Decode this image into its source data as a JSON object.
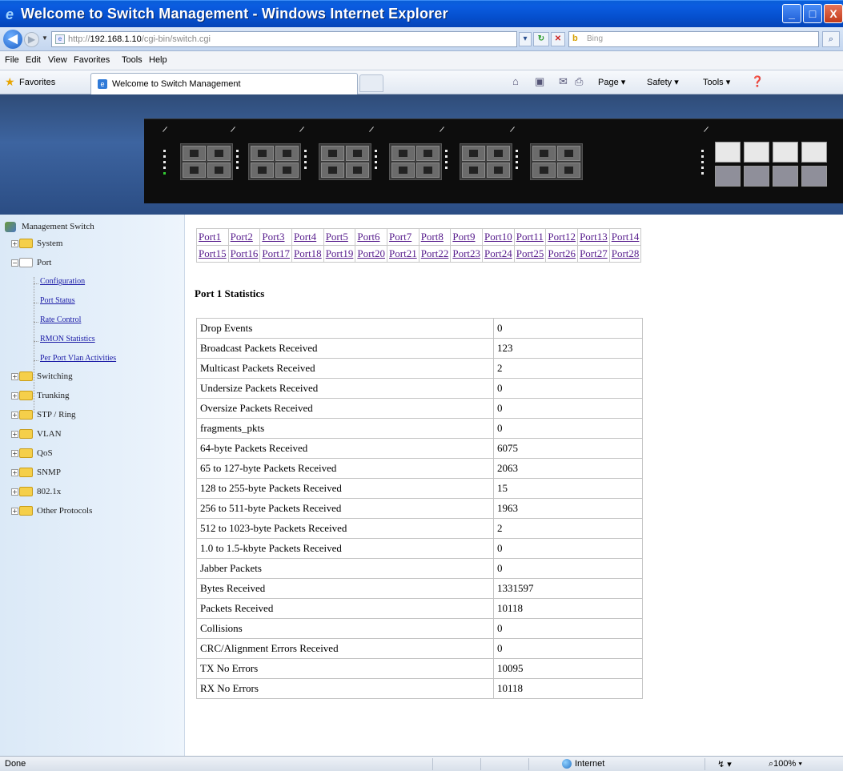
{
  "window": {
    "title": "Welcome to Switch Management - Windows Internet Explorer",
    "min_glyph": "_",
    "max_glyph": "□",
    "close_glyph": "X"
  },
  "address": {
    "url_prefix": "http://",
    "url_host": "192.168.1.10",
    "url_path": "/cgi-bin/switch.cgi",
    "search_placeholder": "Bing"
  },
  "menu": [
    "File",
    "Edit",
    "View",
    "Favorites",
    "Tools",
    "Help"
  ],
  "favbar": {
    "favorites_label": "Favorites",
    "tab_title": "Welcome to Switch Management",
    "commands": [
      "Page ▾",
      "Safety ▾",
      "Tools ▾"
    ]
  },
  "sidebar": {
    "root": "Management Switch",
    "folders": [
      {
        "label": "System",
        "expanded": false
      },
      {
        "label": "Port",
        "expanded": true
      },
      {
        "label": "Switching",
        "expanded": false
      },
      {
        "label": "Trunking",
        "expanded": false
      },
      {
        "label": "STP / Ring",
        "expanded": false
      },
      {
        "label": "VLAN",
        "expanded": false
      },
      {
        "label": "QoS",
        "expanded": false
      },
      {
        "label": "SNMP",
        "expanded": false
      },
      {
        "label": "802.1x",
        "expanded": false
      },
      {
        "label": "Other Protocols",
        "expanded": false
      }
    ],
    "port_children": [
      "Configuration",
      "Port Status",
      "Rate Control",
      "RMON Statistics",
      "Per Port Vlan Activities"
    ]
  },
  "port_links": {
    "row1": [
      "Port1",
      "Port2",
      "Port3",
      "Port4",
      "Port5",
      "Port6",
      "Port7",
      "Port8",
      "Port9",
      "Port10",
      "Port11",
      "Port12",
      "Port13",
      "Port14"
    ],
    "row2": [
      "Port15",
      "Port16",
      "Port17",
      "Port18",
      "Port19",
      "Port20",
      "Port21",
      "Port22",
      "Port23",
      "Port24",
      "Port25",
      "Port26",
      "Port27",
      "Port28"
    ]
  },
  "stats": {
    "title": "Port 1 Statistics",
    "rows": [
      [
        "Drop Events",
        "0"
      ],
      [
        "Broadcast Packets Received",
        "123"
      ],
      [
        "Multicast Packets Received",
        "2"
      ],
      [
        "Undersize Packets Received",
        "0"
      ],
      [
        "Oversize Packets Received",
        "0"
      ],
      [
        "fragments_pkts",
        "0"
      ],
      [
        "64-byte Packets Received",
        "6075"
      ],
      [
        "65 to 127-byte Packets Received",
        "2063"
      ],
      [
        "128 to 255-byte Packets Received",
        "15"
      ],
      [
        "256 to 511-byte Packets Received",
        "1963"
      ],
      [
        "512 to 1023-byte Packets Received",
        "2"
      ],
      [
        "1.0 to 1.5-kbyte Packets Received",
        "0"
      ],
      [
        "Jabber Packets",
        "0"
      ],
      [
        "Bytes Received",
        "1331597"
      ],
      [
        "Packets Received",
        "10118"
      ],
      [
        "Collisions",
        "0"
      ],
      [
        "CRC/Alignment Errors Received",
        "0"
      ],
      [
        "TX No Errors",
        "10095"
      ],
      [
        "RX No Errors",
        "10118"
      ]
    ]
  },
  "status": {
    "left": "Done",
    "zone": "Internet",
    "zoom": "100%"
  },
  "colors": {
    "titlebar": "#0550cf",
    "sidebar_bg": "#dbe9f7",
    "visited_link": "#551a8b",
    "banner": "#3d64a0"
  }
}
